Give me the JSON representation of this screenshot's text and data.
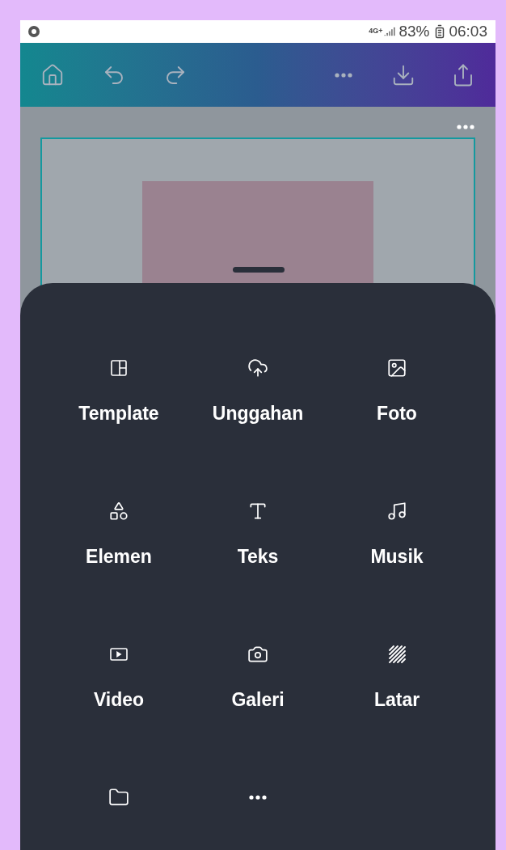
{
  "status_bar": {
    "network": "4G+",
    "battery": "83%",
    "time": "06:03"
  },
  "toolbar": {
    "left": [
      {
        "kind": "home"
      },
      {
        "kind": "undo"
      },
      {
        "kind": "redo"
      }
    ],
    "right": [
      {
        "kind": "more"
      },
      {
        "kind": "download"
      },
      {
        "kind": "share"
      }
    ]
  },
  "menu": {
    "items": [
      {
        "kind": "template",
        "label": "Template"
      },
      {
        "kind": "upload",
        "label": "Unggahan"
      },
      {
        "kind": "photo",
        "label": "Foto"
      },
      {
        "kind": "elements",
        "label": "Elemen"
      },
      {
        "kind": "text",
        "label": "Teks"
      },
      {
        "kind": "music",
        "label": "Musik"
      },
      {
        "kind": "video",
        "label": "Video"
      },
      {
        "kind": "camera",
        "label": "Galeri"
      },
      {
        "kind": "background",
        "label": "Latar"
      },
      {
        "kind": "folder"
      },
      {
        "kind": "more"
      }
    ]
  }
}
